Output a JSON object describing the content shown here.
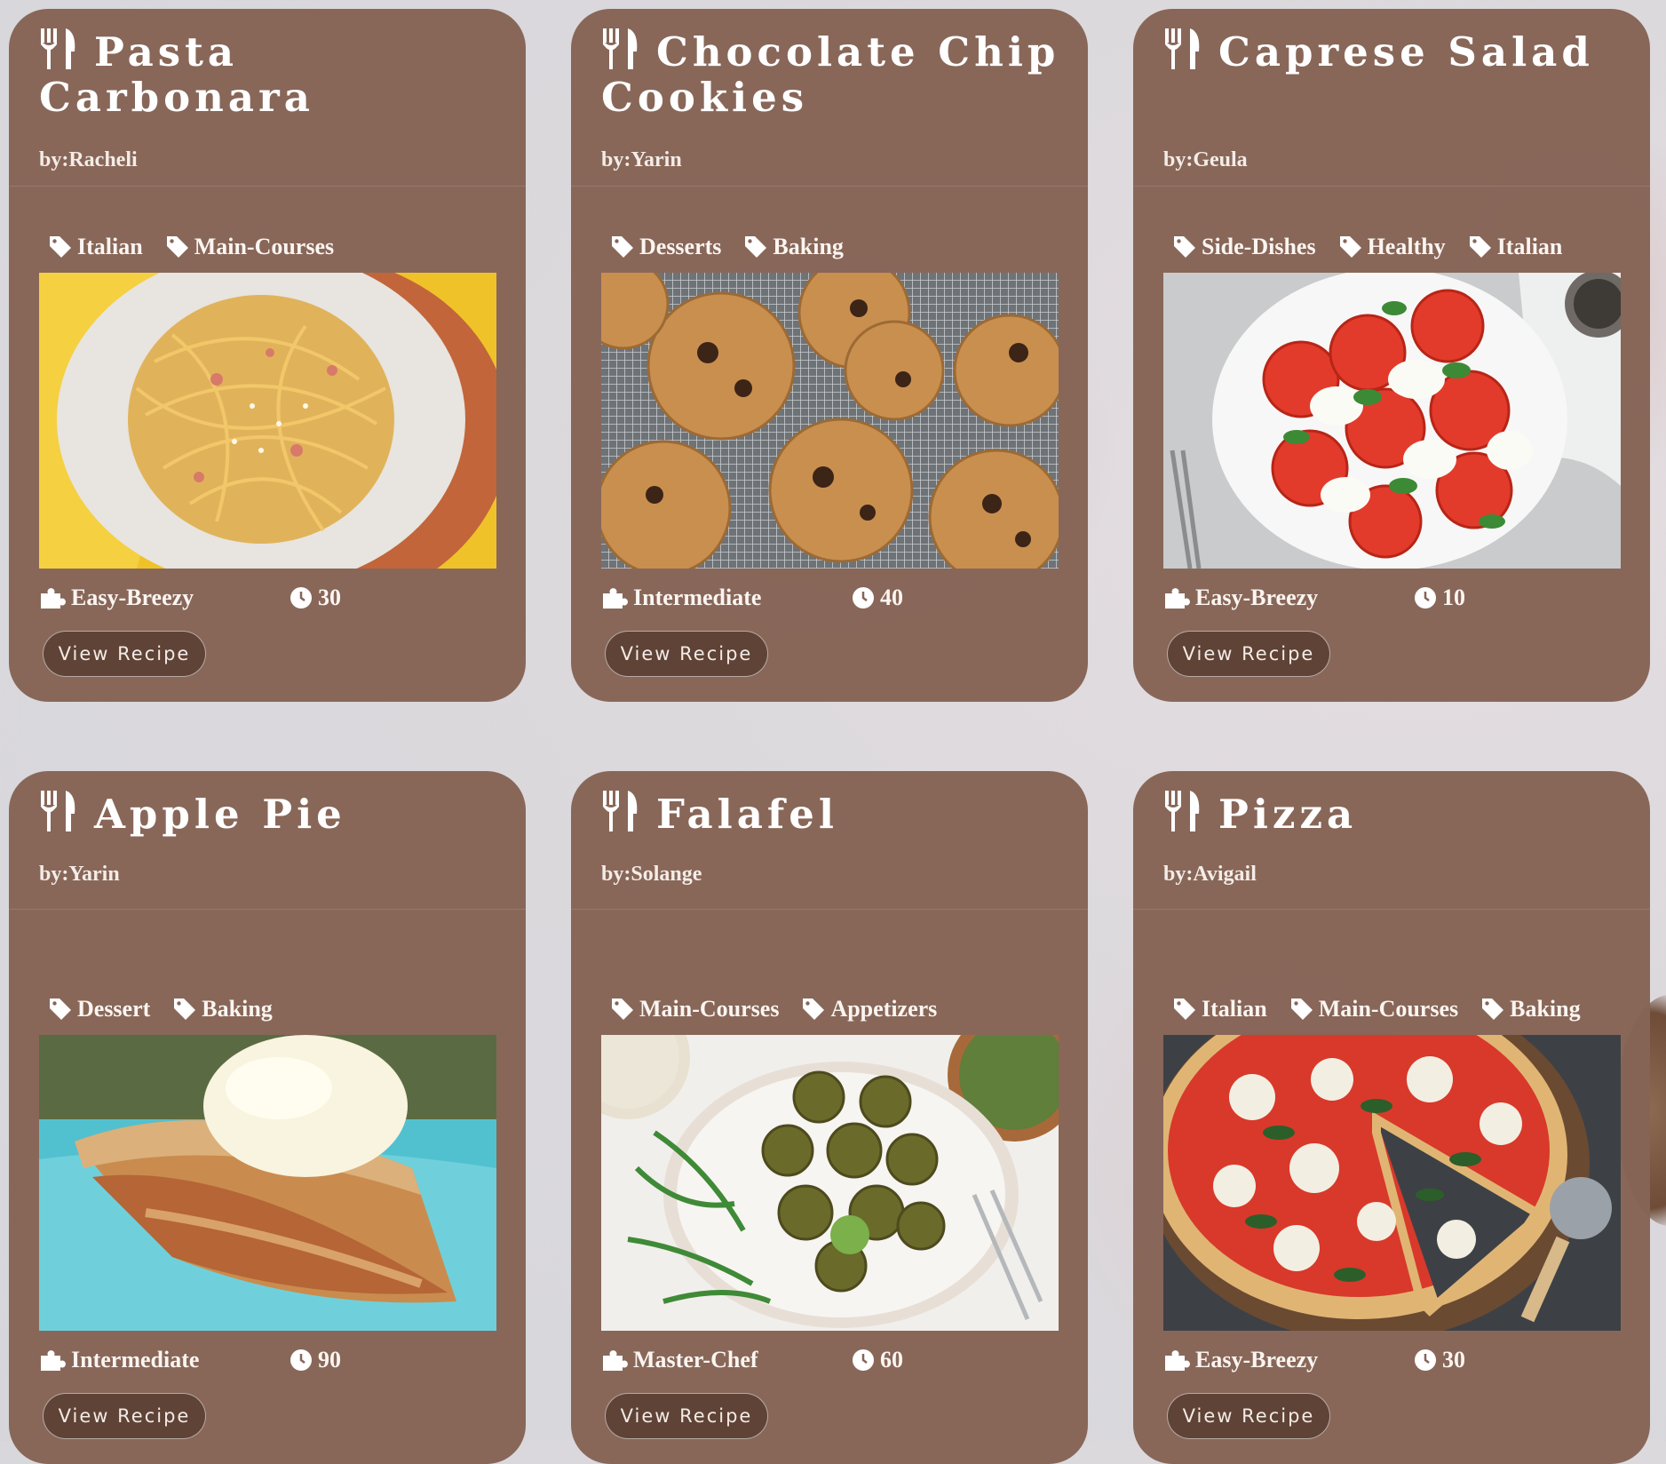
{
  "colors": {
    "card": "#86645a",
    "button": "#5f4336",
    "background": "#d8d7db"
  },
  "icons": {
    "title": "fork-knife-icon",
    "tag": "tag-icon",
    "level": "puzzle-icon",
    "time": "clock-icon"
  },
  "recipes": [
    {
      "title": "Pasta Carbonara",
      "author": "by:Racheli",
      "tags": [
        "Italian",
        "Main-Courses"
      ],
      "level": "Easy-Breezy",
      "time": "30",
      "button": "View Recipe",
      "photo": "pasta-photo"
    },
    {
      "title": "Chocolate Chip Cookies",
      "author": "by:Yarin",
      "tags": [
        "Desserts",
        "Baking"
      ],
      "level": "Intermediate",
      "time": "40",
      "button": "View Recipe",
      "photo": "cookies-photo"
    },
    {
      "title": "Caprese Salad",
      "author": "by:Geula",
      "tags": [
        "Side-Dishes",
        "Healthy",
        "Italian"
      ],
      "level": "Easy-Breezy",
      "time": "10",
      "button": "View Recipe",
      "photo": "caprese-photo"
    },
    {
      "title": "Apple Pie",
      "author": "by:Yarin",
      "tags": [
        "Dessert",
        "Baking"
      ],
      "level": "Intermediate",
      "time": "90",
      "button": "View Recipe",
      "photo": "apple-pie-photo"
    },
    {
      "title": "Falafel",
      "author": "by:Solange",
      "tags": [
        "Main-Courses",
        "Appetizers"
      ],
      "level": "Master-Chef",
      "time": "60",
      "button": "View Recipe",
      "photo": "falafel-photo"
    },
    {
      "title": "Pizza",
      "author": "by:Avigail",
      "tags": [
        "Italian",
        "Main-Courses",
        "Baking"
      ],
      "level": "Easy-Breezy",
      "time": "30",
      "button": "View Recipe",
      "photo": "pizza-photo"
    }
  ]
}
